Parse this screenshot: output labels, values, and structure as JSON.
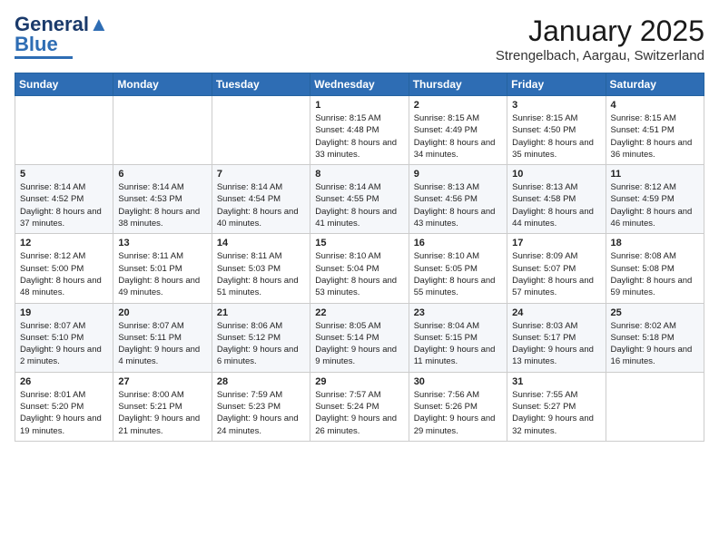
{
  "header": {
    "logo_line1": "General",
    "logo_line2": "Blue",
    "month_title": "January 2025",
    "location": "Strengelbach, Aargau, Switzerland"
  },
  "weekdays": [
    "Sunday",
    "Monday",
    "Tuesday",
    "Wednesday",
    "Thursday",
    "Friday",
    "Saturday"
  ],
  "weeks": [
    [
      {
        "day": "",
        "sunrise": "",
        "sunset": "",
        "daylight": ""
      },
      {
        "day": "",
        "sunrise": "",
        "sunset": "",
        "daylight": ""
      },
      {
        "day": "",
        "sunrise": "",
        "sunset": "",
        "daylight": ""
      },
      {
        "day": "1",
        "sunrise": "8:15 AM",
        "sunset": "4:48 PM",
        "daylight": "8 hours and 33 minutes."
      },
      {
        "day": "2",
        "sunrise": "8:15 AM",
        "sunset": "4:49 PM",
        "daylight": "8 hours and 34 minutes."
      },
      {
        "day": "3",
        "sunrise": "8:15 AM",
        "sunset": "4:50 PM",
        "daylight": "8 hours and 35 minutes."
      },
      {
        "day": "4",
        "sunrise": "8:15 AM",
        "sunset": "4:51 PM",
        "daylight": "8 hours and 36 minutes."
      }
    ],
    [
      {
        "day": "5",
        "sunrise": "8:14 AM",
        "sunset": "4:52 PM",
        "daylight": "8 hours and 37 minutes."
      },
      {
        "day": "6",
        "sunrise": "8:14 AM",
        "sunset": "4:53 PM",
        "daylight": "8 hours and 38 minutes."
      },
      {
        "day": "7",
        "sunrise": "8:14 AM",
        "sunset": "4:54 PM",
        "daylight": "8 hours and 40 minutes."
      },
      {
        "day": "8",
        "sunrise": "8:14 AM",
        "sunset": "4:55 PM",
        "daylight": "8 hours and 41 minutes."
      },
      {
        "day": "9",
        "sunrise": "8:13 AM",
        "sunset": "4:56 PM",
        "daylight": "8 hours and 43 minutes."
      },
      {
        "day": "10",
        "sunrise": "8:13 AM",
        "sunset": "4:58 PM",
        "daylight": "8 hours and 44 minutes."
      },
      {
        "day": "11",
        "sunrise": "8:12 AM",
        "sunset": "4:59 PM",
        "daylight": "8 hours and 46 minutes."
      }
    ],
    [
      {
        "day": "12",
        "sunrise": "8:12 AM",
        "sunset": "5:00 PM",
        "daylight": "8 hours and 48 minutes."
      },
      {
        "day": "13",
        "sunrise": "8:11 AM",
        "sunset": "5:01 PM",
        "daylight": "8 hours and 49 minutes."
      },
      {
        "day": "14",
        "sunrise": "8:11 AM",
        "sunset": "5:03 PM",
        "daylight": "8 hours and 51 minutes."
      },
      {
        "day": "15",
        "sunrise": "8:10 AM",
        "sunset": "5:04 PM",
        "daylight": "8 hours and 53 minutes."
      },
      {
        "day": "16",
        "sunrise": "8:10 AM",
        "sunset": "5:05 PM",
        "daylight": "8 hours and 55 minutes."
      },
      {
        "day": "17",
        "sunrise": "8:09 AM",
        "sunset": "5:07 PM",
        "daylight": "8 hours and 57 minutes."
      },
      {
        "day": "18",
        "sunrise": "8:08 AM",
        "sunset": "5:08 PM",
        "daylight": "8 hours and 59 minutes."
      }
    ],
    [
      {
        "day": "19",
        "sunrise": "8:07 AM",
        "sunset": "5:10 PM",
        "daylight": "9 hours and 2 minutes."
      },
      {
        "day": "20",
        "sunrise": "8:07 AM",
        "sunset": "5:11 PM",
        "daylight": "9 hours and 4 minutes."
      },
      {
        "day": "21",
        "sunrise": "8:06 AM",
        "sunset": "5:12 PM",
        "daylight": "9 hours and 6 minutes."
      },
      {
        "day": "22",
        "sunrise": "8:05 AM",
        "sunset": "5:14 PM",
        "daylight": "9 hours and 9 minutes."
      },
      {
        "day": "23",
        "sunrise": "8:04 AM",
        "sunset": "5:15 PM",
        "daylight": "9 hours and 11 minutes."
      },
      {
        "day": "24",
        "sunrise": "8:03 AM",
        "sunset": "5:17 PM",
        "daylight": "9 hours and 13 minutes."
      },
      {
        "day": "25",
        "sunrise": "8:02 AM",
        "sunset": "5:18 PM",
        "daylight": "9 hours and 16 minutes."
      }
    ],
    [
      {
        "day": "26",
        "sunrise": "8:01 AM",
        "sunset": "5:20 PM",
        "daylight": "9 hours and 19 minutes."
      },
      {
        "day": "27",
        "sunrise": "8:00 AM",
        "sunset": "5:21 PM",
        "daylight": "9 hours and 21 minutes."
      },
      {
        "day": "28",
        "sunrise": "7:59 AM",
        "sunset": "5:23 PM",
        "daylight": "9 hours and 24 minutes."
      },
      {
        "day": "29",
        "sunrise": "7:57 AM",
        "sunset": "5:24 PM",
        "daylight": "9 hours and 26 minutes."
      },
      {
        "day": "30",
        "sunrise": "7:56 AM",
        "sunset": "5:26 PM",
        "daylight": "9 hours and 29 minutes."
      },
      {
        "day": "31",
        "sunrise": "7:55 AM",
        "sunset": "5:27 PM",
        "daylight": "9 hours and 32 minutes."
      },
      {
        "day": "",
        "sunrise": "",
        "sunset": "",
        "daylight": ""
      }
    ]
  ]
}
